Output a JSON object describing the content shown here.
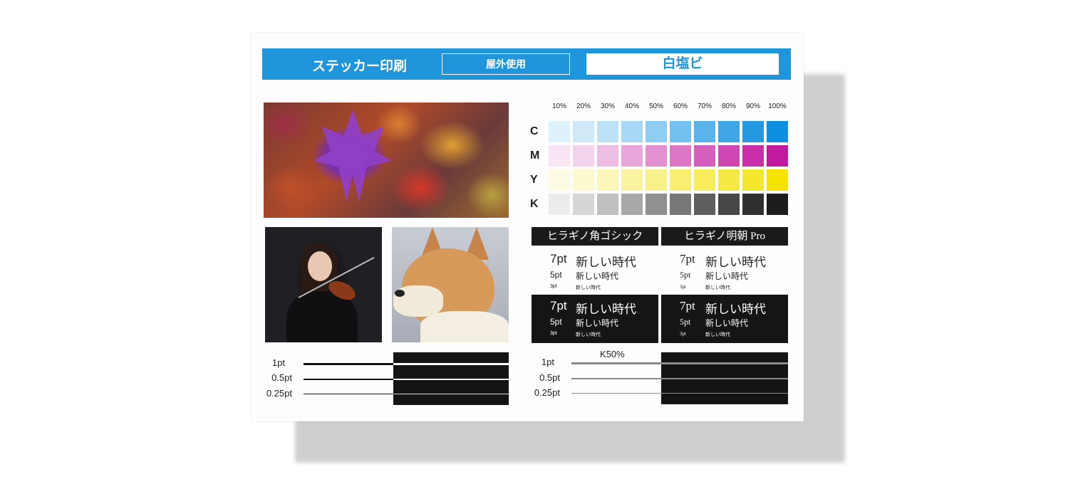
{
  "header": {
    "title": "ステッカー印刷",
    "usage": "屋外使用",
    "material": "白塩ビ"
  },
  "photos": {
    "leaves": "photo-autumn-leaves",
    "violinist": "photo-violinist",
    "dog": "photo-shiba-dog"
  },
  "color_chart": {
    "percentages": [
      "10%",
      "20%",
      "30%",
      "40%",
      "50%",
      "60%",
      "70%",
      "80%",
      "90%",
      "100%"
    ],
    "rows": [
      {
        "label": "C",
        "colors": [
          "#dff1fb",
          "#cfe9f9",
          "#bde1f7",
          "#a8d8f5",
          "#8fcdf2",
          "#74c0ee",
          "#5ab4eb",
          "#3ea6e6",
          "#2499e2",
          "#0e8fdf"
        ]
      },
      {
        "label": "M",
        "colors": [
          "#f8e6f4",
          "#f3d2ec",
          "#eebde3",
          "#e8a6da",
          "#e290d0",
          "#dc76c6",
          "#d65ebc",
          "#cf45b2",
          "#c92ea8",
          "#c21a9f"
        ]
      },
      {
        "label": "Y",
        "colors": [
          "#fdfbe3",
          "#fcf9cf",
          "#fbf6b9",
          "#faf4a2",
          "#f9f18a",
          "#f8ee72",
          "#f7ec5a",
          "#f6e943",
          "#f5e72c",
          "#f4e400"
        ]
      },
      {
        "label": "K",
        "colors": [
          "#ececec",
          "#d6d6d6",
          "#c0c0c0",
          "#a8a8a8",
          "#909090",
          "#777777",
          "#5e5e5e",
          "#474747",
          "#303030",
          "#1c1c1c"
        ]
      }
    ]
  },
  "fonts": {
    "gothic": {
      "name": "ヒラギノ角ゴシック",
      "samples": [
        {
          "size": "7pt",
          "text": "新しい時代"
        },
        {
          "size": "5pt",
          "text": "新しい時代"
        },
        {
          "size": "3pt",
          "text": "新しい時代"
        }
      ]
    },
    "mincho": {
      "name": "ヒラギノ明朝 Pro",
      "samples": [
        {
          "size": "7pt",
          "text": "新しい時代"
        },
        {
          "size": "5pt",
          "text": "新しい時代"
        },
        {
          "size": "3pt",
          "text": "新しい時代"
        }
      ]
    }
  },
  "lines": {
    "labels": [
      "1pt",
      "0.5pt",
      "0.25pt"
    ],
    "k50_label": "K50%"
  }
}
